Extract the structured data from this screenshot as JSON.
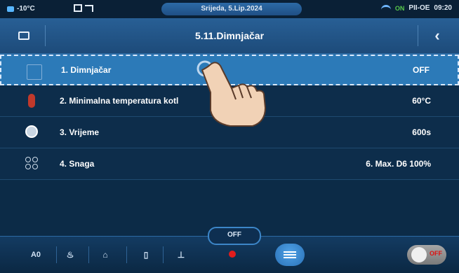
{
  "status": {
    "temperature": "-10°C",
    "date": "Srijeda, 5.Lip.2024",
    "mode": "PII-OE",
    "time": "09:20",
    "on_badge": "ON"
  },
  "header": {
    "title": "5.11.Dimnjačar"
  },
  "list": [
    {
      "label": "1. Dimnjačar",
      "value": "OFF"
    },
    {
      "label": "2. Minimalna temperatura kotl",
      "value": "60°C"
    },
    {
      "label": "3. Vrijeme",
      "value": "600s"
    },
    {
      "label": "4. Snaga",
      "value": "6. Max. D6 100%"
    }
  ],
  "bottom": {
    "first_label": "A0",
    "off_tab": "OFF",
    "toggle_text": "OFF"
  },
  "colors": {
    "background": "#0c2b47",
    "header": "#1d4b7a",
    "selected_row": "#2c7ab8",
    "alert_red": "#e21d1d"
  }
}
